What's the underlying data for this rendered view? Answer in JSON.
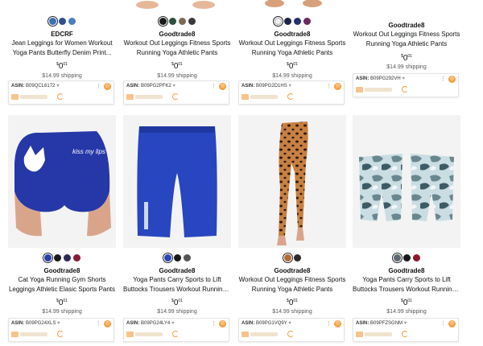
{
  "products": [
    {
      "brand": "EDCRF",
      "title_lines": [
        "Jean Leggings for Women Workout",
        "Yoga Pants Butterfly Denim Print..."
      ],
      "price_currency": "$",
      "price_whole": "0",
      "price_fraction": "01",
      "shipping": "$14.99 shipping",
      "asin_label": "ASIN:",
      "asin": "B09QCL6172",
      "swatches": [
        "#3b6fb6",
        "#2f4f8f",
        "#4a7fc2"
      ]
    },
    {
      "brand": "Goodtrade8",
      "title_lines": [
        "Workout Out Leggings Fitness Sports",
        "Running Yoga Athletic Pants"
      ],
      "price_currency": "$",
      "price_whole": "0",
      "price_fraction": "01",
      "shipping": "$14.99 shipping",
      "asin_label": "ASIN:",
      "asin": "B09PG2PFK2",
      "swatches": [
        "#1a1a1a",
        "#2e4f3f",
        "#7a6a55",
        "#3a3a3a"
      ]
    },
    {
      "brand": "Goodtrade8",
      "title_lines": [
        "Workout Out Leggings Fitness Sports",
        "Running Yoga Athletic Pants"
      ],
      "price_currency": "$",
      "price_whole": "0",
      "price_fraction": "01",
      "shipping": "$14.99 shipping",
      "asin_label": "ASIN:",
      "asin": "B09PG2D1HS",
      "swatches": [
        "#f2f2f2",
        "#1c2447",
        "#25306e",
        "#6b2a5e"
      ]
    },
    {
      "brand": "Goodtrade8",
      "title_lines": [
        "Workout Out Leggings Fitness Sports",
        "Running Yoga Athletic Pants"
      ],
      "price_currency": "$",
      "price_whole": "0",
      "price_fraction": "01",
      "shipping": "$14.99 shipping",
      "asin_label": "ASIN:",
      "asin": "B09PG292VH",
      "swatches": []
    },
    {
      "brand": "Goodtrade8",
      "title_lines": [
        "Cat Yoga Running Gym Shorts",
        "Leggings Athletic Elasic Sports Pants"
      ],
      "price_currency": "$",
      "price_whole": "0",
      "price_fraction": "01",
      "shipping": "$14.99 shipping",
      "asin_label": "ASIN:",
      "asin": "B09PG24XLS",
      "swatches": [
        "#2a3ea8",
        "#1a1a1a",
        "#2a2a5a",
        "#8a1a3a"
      ],
      "image_text": "kiss my lips"
    },
    {
      "brand": "Goodtrade8",
      "title_lines": [
        "Yoga Pants Carry Sports to Lift",
        "Buttocks Trousers Workout Running..."
      ],
      "price_currency": "$",
      "price_whole": "0",
      "price_fraction": "01",
      "shipping": "$14.99 shipping",
      "asin_label": "ASIN:",
      "asin": "B09PG24LY4",
      "swatches": [
        "#2b45b8",
        "#1a1a1a",
        "#555555"
      ]
    },
    {
      "brand": "Goodtrade8",
      "title_lines": [
        "Workout Out Leggings Fitness Sports",
        "Running Yoga Athletic Pants"
      ],
      "price_currency": "$",
      "price_whole": "0",
      "price_fraction": "01",
      "shipping": "$14.99 shipping",
      "asin_label": "ASIN:",
      "asin": "B09PG1VQ9Y",
      "swatches": [
        "#b36a35",
        "#2a2a2a"
      ]
    },
    {
      "brand": "Goodtrade8",
      "title_lines": [
        "Yoga Pants Carry Sports to Lift",
        "Buttocks Trousers Workout Running..."
      ],
      "price_currency": "$",
      "price_whole": "0",
      "price_fraction": "01",
      "shipping": "$14.99 shipping",
      "asin_label": "ASIN:",
      "asin": "B09PFZSGNM",
      "swatches": [
        "#5a6a70",
        "#1a1a1a",
        "#8a1a2a"
      ]
    }
  ],
  "colors": {
    "accent": "#f6a041",
    "link": "#0f1111",
    "shipping": "#565959"
  }
}
